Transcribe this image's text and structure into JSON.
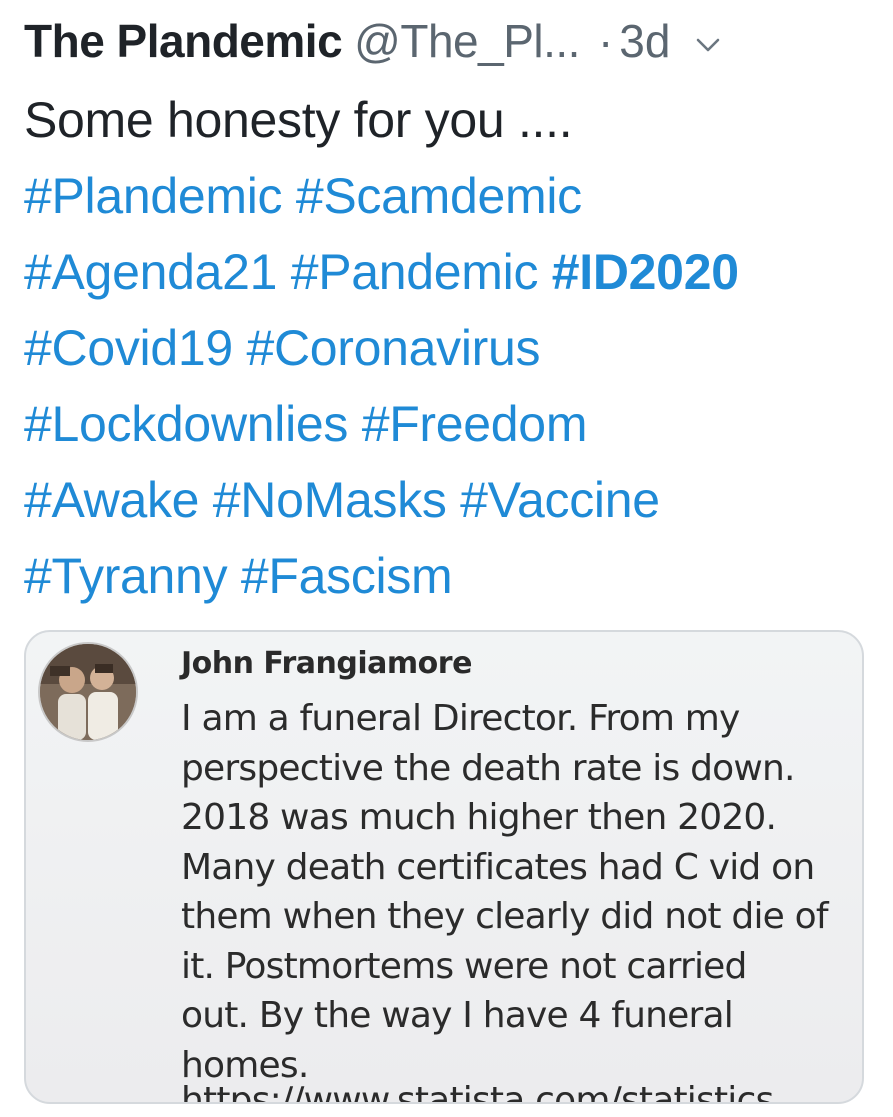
{
  "tweet": {
    "author_name": "The Plandemic",
    "author_handle": "@The_Pl...",
    "separator": "·",
    "time": "3d",
    "menu_icon": "chevron-down-icon",
    "text": "Some honesty for you ....",
    "hashtag_lines": [
      [
        "#Plandemic",
        "#Scamdemic"
      ],
      [
        "#Agenda21",
        "#Pandemic",
        "#ID2020"
      ],
      [
        "#Covid19",
        "#Coronavirus"
      ],
      [
        "#Lockdownlies",
        "#Freedom"
      ],
      [
        "#Awake",
        "#NoMasks",
        "#Vaccine"
      ],
      [
        "#Tyranny",
        "#Fascism"
      ]
    ],
    "bold_hashtag": "#ID2020",
    "link_color": "#1f8ad6"
  },
  "media": {
    "post_author": "John Frangiamore",
    "post_lines": [
      "I am a funeral Director. From my",
      "perspective the death rate is down.",
      "2018 was much higher then 2020.",
      "Many death certificates had C vid on",
      "them when they clearly did not die of",
      "it. Postmortems were not carried",
      "out. By the way I have 4 funeral",
      "homes."
    ],
    "post_link": "https://www.statista.com/statistics"
  }
}
